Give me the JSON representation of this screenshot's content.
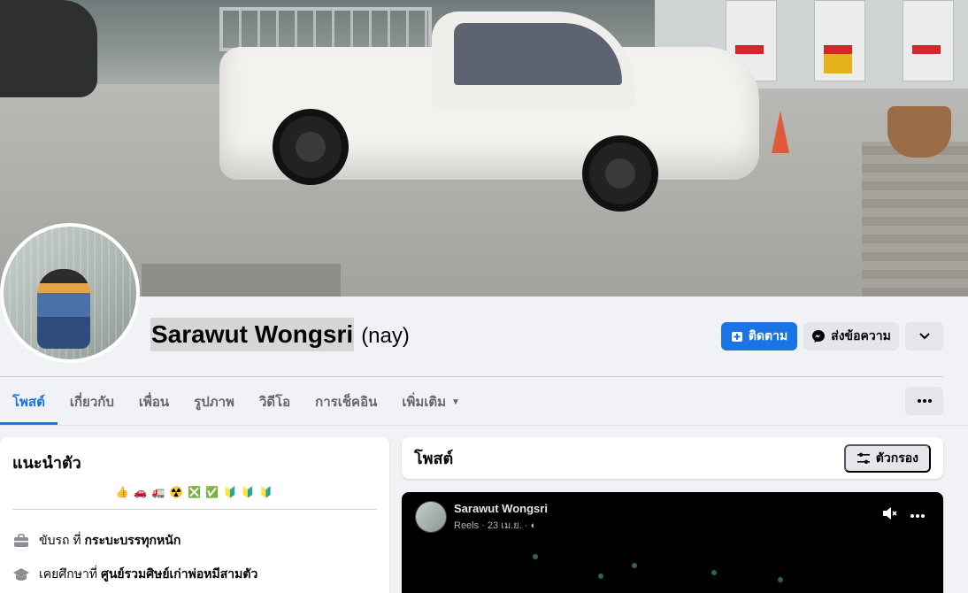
{
  "profile": {
    "name": "Sarawut Wongsri",
    "alternate_name": "(nay)"
  },
  "actions": {
    "follow_label": "ติดตาม",
    "message_label": "ส่งข้อความ",
    "more_icon": "chevron-down-icon"
  },
  "tabs": [
    {
      "label": "โพสต์",
      "active": true
    },
    {
      "label": "เกี่ยวกับ",
      "active": false
    },
    {
      "label": "เพื่อน",
      "active": false
    },
    {
      "label": "รูปภาพ",
      "active": false
    },
    {
      "label": "วิดีโอ",
      "active": false
    },
    {
      "label": "การเช็คอิน",
      "active": false
    },
    {
      "label": "เพิ่มเติม",
      "active": false
    }
  ],
  "intro": {
    "title": "แนะนำตัว",
    "bio": "👍 🚗 🚛 ☢️ ❎ ✅ 🔰 🔰 🔰",
    "rows": [
      {
        "icon": "briefcase-icon",
        "prefix": "ขับรถ ที่ ",
        "value": "กระบะบรรทุกหนัก"
      },
      {
        "icon": "graduation-cap-icon",
        "prefix": "เคยศึกษาที่ ",
        "value": "ศูนย์รวมศิษย์เก่าพ่อหมีสามตัว"
      }
    ]
  },
  "posts": {
    "title": "โพสต์",
    "filter_label": "ตัวกรอง",
    "reel": {
      "author": "Sarawut Wongsri",
      "meta": "Reels · 23 เม.ย. · "
    }
  },
  "colors": {
    "accent": "#1b74e4",
    "button_gray": "#e4e6eb",
    "background": "#f0f2f5"
  }
}
